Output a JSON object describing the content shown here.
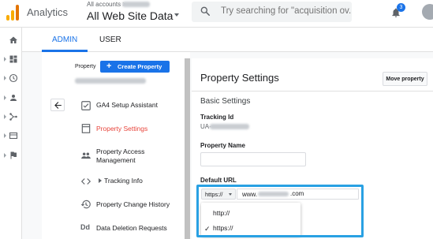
{
  "topbar": {
    "app_name": "Analytics",
    "account_prefix": "All accounts",
    "property_name": "All Web Site Data",
    "search_placeholder": "Try searching for \"acquisition ov...",
    "notification_count": "3"
  },
  "tabs": {
    "admin": "ADMIN",
    "user": "USER"
  },
  "admin_column": {
    "property_label": "Property",
    "create_property": "Create Property",
    "menu": [
      {
        "label": "GA4 Setup Assistant",
        "icon": "checklist-icon",
        "active": false
      },
      {
        "label": "Property Settings",
        "icon": "settings-page-icon",
        "active": true
      },
      {
        "label": "Property Access Management",
        "icon": "people-icon",
        "active": false
      },
      {
        "label": "Tracking Info",
        "icon": "code-icon",
        "active": false
      },
      {
        "label": "Property Change History",
        "icon": "history-icon",
        "active": false
      },
      {
        "label": "Data Deletion Requests",
        "icon": "dd-icon",
        "active": false
      }
    ]
  },
  "settings": {
    "title": "Property Settings",
    "move_button": "Move property",
    "section": "Basic Settings",
    "tracking_id_label": "Tracking Id",
    "tracking_id_prefix": "UA-",
    "property_name_label": "Property Name",
    "default_url_label": "Default URL",
    "protocol_selected": "https://",
    "url_prefix": "www.",
    "url_suffix": ".com",
    "protocol_options": [
      "http://",
      "https://"
    ]
  },
  "colors": {
    "accent": "#1a73e8",
    "active_menu": "#e8453c",
    "highlight_border": "#29a1e3",
    "logo": "#f9ab00"
  }
}
